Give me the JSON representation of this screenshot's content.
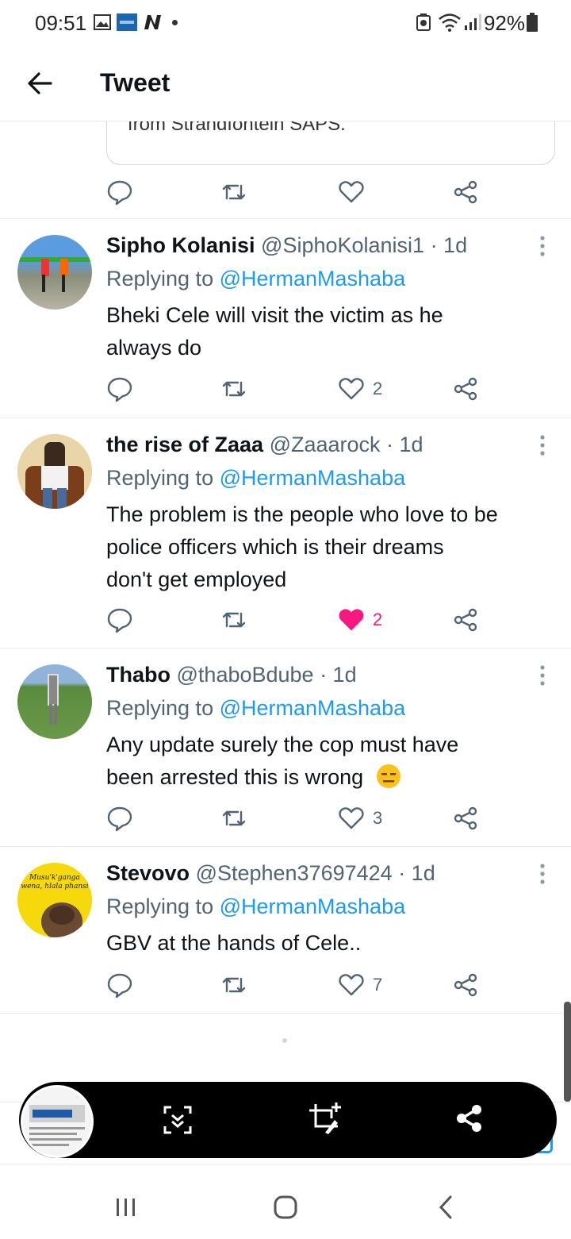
{
  "status_bar": {
    "time": "09:51",
    "battery": "92%"
  },
  "header": {
    "title": "Tweet"
  },
  "quoted_card": {
    "text": "from Strandfontein SAPS."
  },
  "tweets": [
    {
      "name": "Sipho Kolanisi",
      "handle": "@SiphoKolanisi1 · 1d",
      "replying_label": "Replying to ",
      "replying_to": "@HermanMashaba",
      "lines": [
        "Bheki Cele will visit the victim as he",
        "always do"
      ],
      "likes": "2",
      "liked": false
    },
    {
      "name": "the rise of Zaaa",
      "handle": "@Zaaarock · 1d",
      "replying_label": "Replying to ",
      "replying_to": "@HermanMashaba",
      "lines": [
        "The problem is the people who love to be",
        "police officers which is their dreams",
        "don't get employed"
      ],
      "likes": "2",
      "liked": true
    },
    {
      "name": "Thabo",
      "handle": "@thaboBdube · 1d",
      "replying_label": "Replying to ",
      "replying_to": "@HermanMashaba",
      "lines": [
        "Any update surely the cop must have",
        "been arrested this is wrong"
      ],
      "likes": "3",
      "liked": false
    },
    {
      "name": "Stevovo",
      "handle": "@Stephen37697424 · 1d",
      "replying_label": "Replying to ",
      "replying_to": "@HermanMashaba",
      "lines": [
        "GBV at the hands of Cele.."
      ],
      "likes": "7",
      "liked": false,
      "avatar_text": [
        "Musu'k'ganga",
        "wena, hlala phansi"
      ]
    }
  ],
  "colors": {
    "accent": "#1d9bf0",
    "like": "#f91880",
    "text": "#0f1419",
    "muted": "#536471"
  }
}
